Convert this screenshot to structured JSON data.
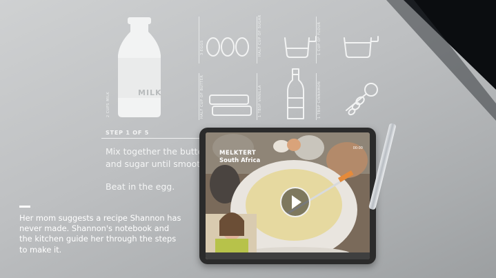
{
  "recipe_guide": {
    "ingredients": [
      {
        "label": "MILK",
        "amount_label": "2 CUPS MILK"
      },
      {
        "label": "",
        "amount_label": "3 EGGS"
      },
      {
        "label": "",
        "amount_label": "HALF CUP OF SUGAR"
      },
      {
        "label": "",
        "amount_label": "1 CUP OF FLOUR"
      },
      {
        "label": "",
        "amount_label": "HALF CUP OF BUTTER"
      },
      {
        "label": "",
        "amount_label": "1 TBSP VANILLA"
      },
      {
        "label": "",
        "amount_label": "1 TBSP CINNAMON"
      }
    ],
    "step": {
      "title": "STEP 1 OF 5",
      "line1": "Mix together the butter",
      "line2": "and sugar until smooth.",
      "line3": "Beat in the egg."
    }
  },
  "caption": {
    "text": "Her mom suggests a recipe Shannon has never made. Shannon's notebook and the kitchen guide her through the steps to make it."
  },
  "tablet": {
    "video_title": "MELKTERT",
    "video_subtitle": "South Africa",
    "top_right": "00:00",
    "bottom_left": "",
    "bottom_right": ""
  },
  "colors": {
    "table": "#bfc1c3",
    "accent_whisk": "#e58a3a"
  }
}
